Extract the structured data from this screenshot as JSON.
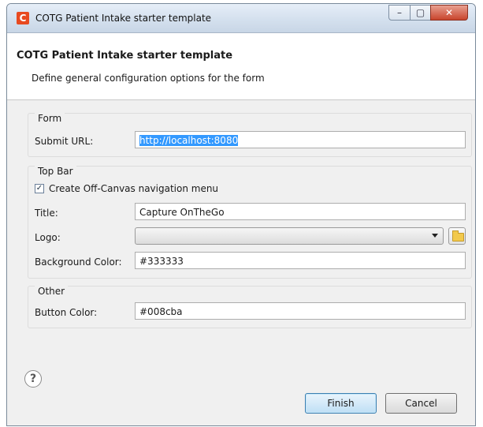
{
  "window": {
    "title": "COTG Patient Intake starter template",
    "app_icon_letter": "C",
    "controls": {
      "minimize": "–",
      "maximize": "▢",
      "close": "✕"
    }
  },
  "header": {
    "title": "COTG Patient Intake starter template",
    "description": "Define general configuration options for the form"
  },
  "form_group": {
    "legend": "Form",
    "submit_url_label": "Submit URL:",
    "submit_url_value": "http://localhost:8080"
  },
  "topbar_group": {
    "legend": "Top Bar",
    "offcanvas_label": "Create Off-Canvas navigation menu",
    "offcanvas_checked": true,
    "title_label": "Title:",
    "title_value": "Capture OnTheGo",
    "logo_label": "Logo:",
    "logo_value": "",
    "bg_color_label": "Background Color:",
    "bg_color_value": "#333333"
  },
  "other_group": {
    "legend": "Other",
    "button_color_label": "Button Color:",
    "button_color_value": "#008cba"
  },
  "footer": {
    "help_symbol": "?",
    "finish_label": "Finish",
    "cancel_label": "Cancel"
  }
}
